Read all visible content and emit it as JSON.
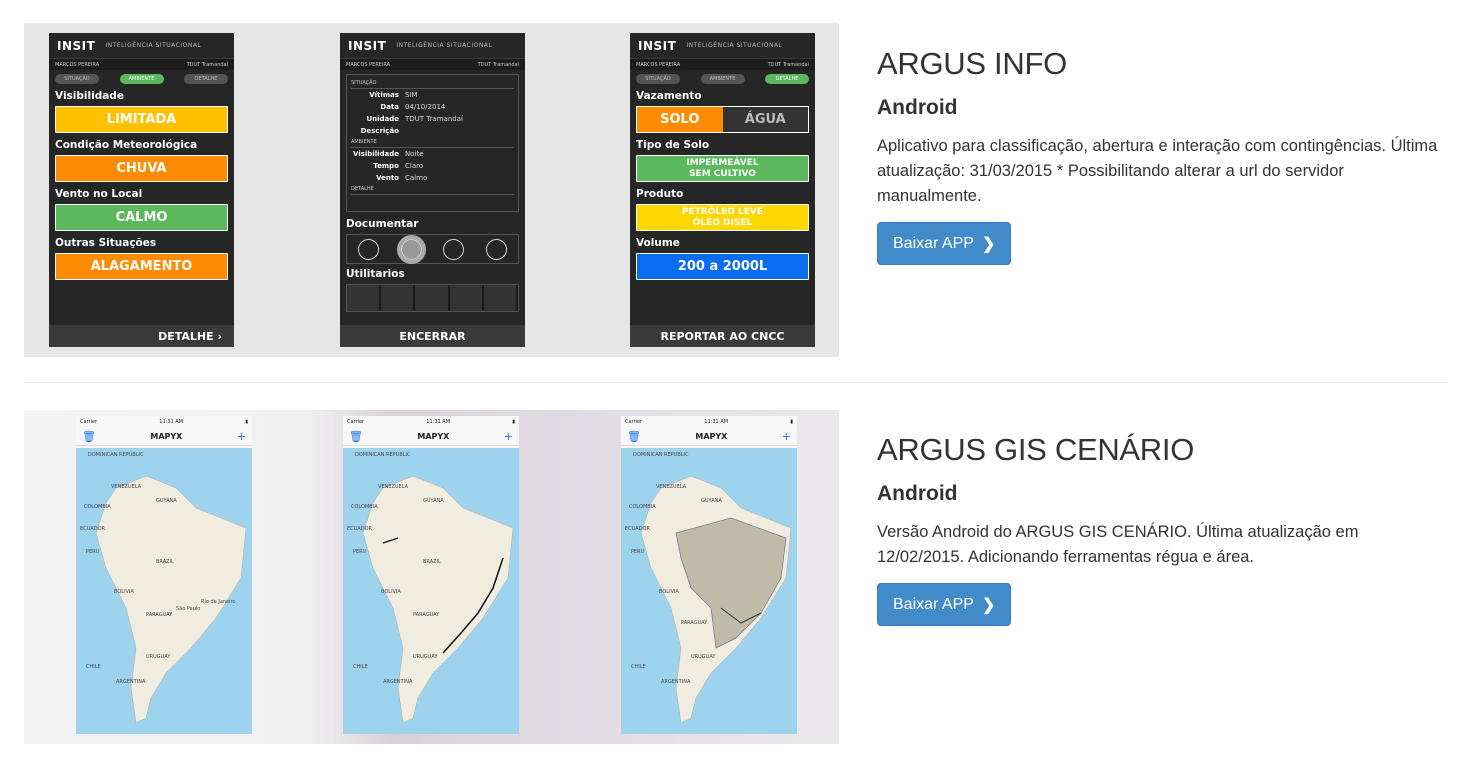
{
  "apps": [
    {
      "title": "ARGUS INFO",
      "platform": "Android",
      "description": "Aplicativo para classificação, abertura e interação com contingências. Última atualização: 31/03/2015 * Possibilitando alterar a url do servidor manualmente.",
      "button_label": "Baixar APP",
      "screens": {
        "logo": "INSIT",
        "tagline": "INTELIGÊNCIA SITUACIONAL",
        "user": "MARCOS PEREIRA",
        "unit": "TDUT Tramandaí",
        "steps": [
          "SITUAÇÃO",
          "AMBIENTE",
          "DETALHE"
        ],
        "screen1": {
          "fields": [
            {
              "label": "Visibilidade",
              "value": "LIMITADA",
              "color": "#ffc000"
            },
            {
              "label": "Condição Meteorológica",
              "value": "CHUVA",
              "color": "#ff8c00"
            },
            {
              "label": "Vento no Local",
              "value": "CALMO",
              "color": "#5cb85c"
            },
            {
              "label": "Outras Situações",
              "value": "ALAGAMENTO",
              "color": "#ff8c00"
            }
          ],
          "footer": "DETALHE ›"
        },
        "screen2": {
          "section1": "SITUAÇÃO",
          "rows1": [
            {
              "k": "Vítimas",
              "v": "SIM"
            },
            {
              "k": "Data",
              "v": "04/10/2014"
            },
            {
              "k": "Unidade",
              "v": "TDUT Tramandaí"
            },
            {
              "k": "Descrição",
              "v": ""
            }
          ],
          "section2": "AMBIENTE",
          "rows2": [
            {
              "k": "Visibilidade",
              "v": "Noite"
            },
            {
              "k": "Tempo",
              "v": "Claro"
            },
            {
              "k": "Vento",
              "v": "Calmo"
            }
          ],
          "section3": "DETALHE",
          "documentar": "Documentar",
          "utilitarios": "Utilitarios",
          "footer": "ENCERRAR"
        },
        "screen3": {
          "vazamento_label": "Vazamento",
          "vazamento_options": [
            "SOLO",
            "ÁGUA"
          ],
          "solo_label": "Tipo de Solo",
          "solo_value_1": "IMPERMEÁVEL",
          "solo_value_2": "SEM CULTIVO",
          "produto_label": "Produto",
          "produto_value_1": "PETRÓLEO LEVE",
          "produto_value_2": "ÓLEO DISEL",
          "volume_label": "Volume",
          "volume_value": "200 a 2000L",
          "footer": "REPORTAR AO CNCC"
        }
      }
    },
    {
      "title": "ARGUS GIS CENÁRIO",
      "platform": "Android",
      "description": "Versão Android do ARGUS GIS CENÁRIO. Última atualização em 12/02/2015. Adicionando ferramentas régua e área.",
      "button_label": "Baixar APP",
      "screens": {
        "carrier": "Carrier",
        "time": "11:31 AM",
        "nav_title": "MAPYX",
        "map_labels": [
          "DOMINICAN REPUBLIC",
          "VENEZUELA",
          "GUYANA",
          "COLOMBIA",
          "ECUADOR",
          "PERU",
          "BRAZIL",
          "BOLIVIA",
          "PARAGUAY",
          "CHILE",
          "URUGUAY",
          "ARGENTINA",
          "São Paulo",
          "Rio de Janeiro"
        ]
      }
    }
  ]
}
